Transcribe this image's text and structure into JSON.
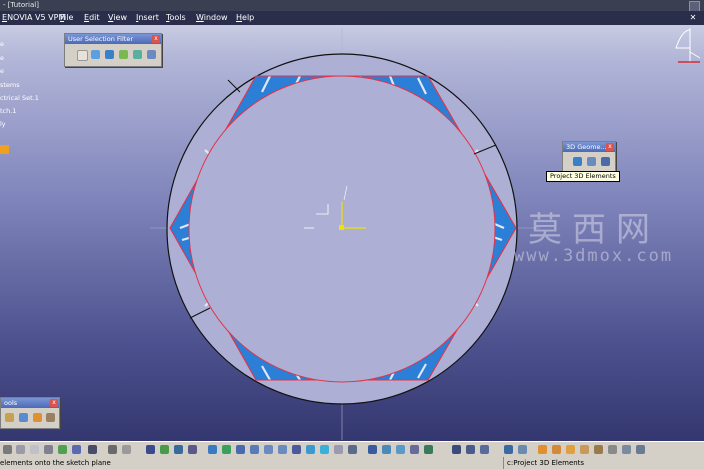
{
  "window": {
    "title_fragment": "- [Tutorial]"
  },
  "menu": {
    "items": [
      "ENOVIA V5 VPM",
      "File",
      "Edit",
      "View",
      "Insert",
      "Tools",
      "Window",
      "Help"
    ]
  },
  "tree": {
    "items": [
      "e",
      "e",
      "e",
      "stems",
      "ctrical Set.1",
      "tch.1",
      "ly"
    ]
  },
  "toolbars": {
    "user_selection_filter": {
      "title": "User Selection Filter"
    },
    "geometry_3d": {
      "title": "3D Geome..."
    },
    "tools": {
      "title": "ools"
    }
  },
  "tooltip": {
    "text": "Project 3D Elements"
  },
  "status": {
    "left": "elements onto the sketch plane",
    "right": "c:Project 3D Elements"
  },
  "watermark": {
    "cn": "莫西网",
    "url": "www.3dmox.com"
  },
  "colors": {
    "accent_red": "#dd1111",
    "profile_red": "#e2344a",
    "hatch_blue": "#2b7fd6",
    "badge_orange": "#f0a020"
  }
}
